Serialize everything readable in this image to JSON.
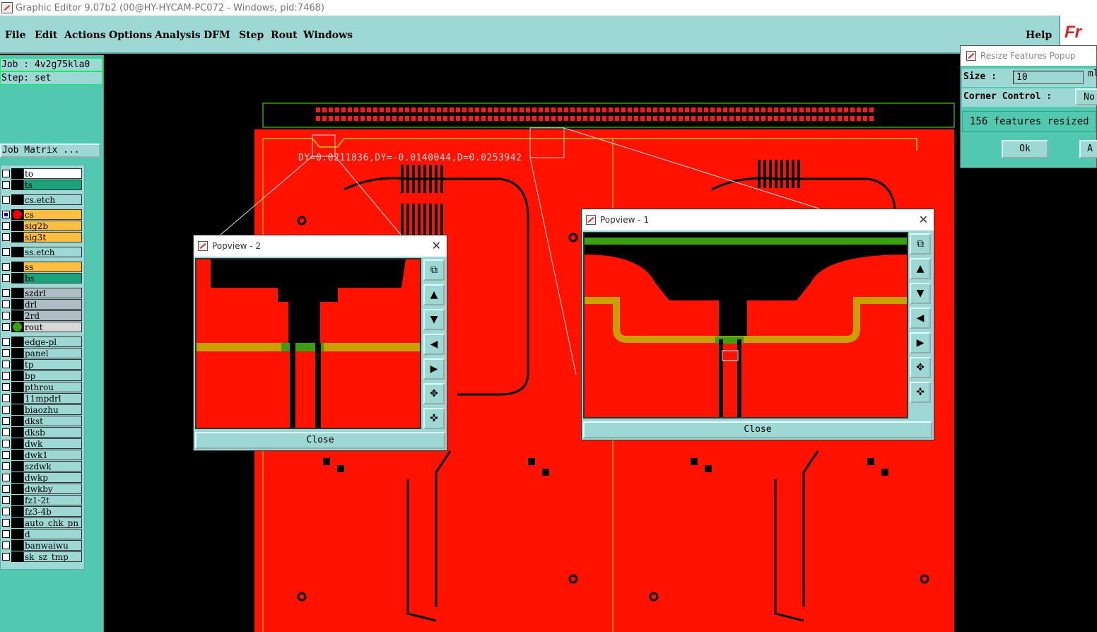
{
  "window": {
    "title": "Graphic Editor 9.07b2 (00@HY-HYCAM-PC072 - Windows, pid:7468)"
  },
  "menu": {
    "items": [
      "File",
      "Edit",
      "Actions",
      "Options",
      "Analysis",
      "DFM",
      "Step",
      "Rout",
      "Windows"
    ],
    "help": "Help",
    "logo_text": "Fr"
  },
  "job": {
    "job_label": "Job : 4v2g75kla0",
    "step_label": "Step: set",
    "matrix_button": "Job Matrix ..."
  },
  "layers": [
    {
      "name": "to",
      "color": "#ffffff",
      "mark": ""
    },
    {
      "name": "ts",
      "color": "#1aa37a",
      "mark": ""
    },
    {
      "name": "cs.etch",
      "color": "#9ed8d4",
      "mark": ""
    },
    {
      "name": "cs",
      "color": "#ffbe40",
      "mark": "red",
      "checked": true
    },
    {
      "name": "sig2b",
      "color": "#ffbe40",
      "mark": ""
    },
    {
      "name": "sig3t",
      "color": "#ffbe40",
      "mark": ""
    },
    {
      "name": "ss.etch",
      "color": "#9ed8d4",
      "mark": ""
    },
    {
      "name": "ss",
      "color": "#ffbe40",
      "mark": ""
    },
    {
      "name": "bs",
      "color": "#1aa37a",
      "mark": ""
    },
    {
      "name": "szdrl",
      "color": "#b0bcc6",
      "mark": ""
    },
    {
      "name": "drl",
      "color": "#b0bcc6",
      "mark": ""
    },
    {
      "name": "2rd",
      "color": "#b0bcc6",
      "mark": ""
    },
    {
      "name": "rout",
      "color": "#d8d8d8",
      "mark": "green"
    },
    {
      "name": "edge-pl",
      "color": "#9ed8d4",
      "mark": ""
    },
    {
      "name": "panel",
      "color": "#9ed8d4",
      "mark": ""
    },
    {
      "name": "tp",
      "color": "#9ed8d4",
      "mark": ""
    },
    {
      "name": "bp",
      "color": "#9ed8d4",
      "mark": ""
    },
    {
      "name": "pthrou",
      "color": "#9ed8d4",
      "mark": ""
    },
    {
      "name": "11mpdrl",
      "color": "#9ed8d4",
      "mark": ""
    },
    {
      "name": "biaozhu",
      "color": "#9ed8d4",
      "mark": ""
    },
    {
      "name": "dkst",
      "color": "#9ed8d4",
      "mark": ""
    },
    {
      "name": "dksb",
      "color": "#9ed8d4",
      "mark": ""
    },
    {
      "name": "dwk",
      "color": "#9ed8d4",
      "mark": ""
    },
    {
      "name": "dwk1",
      "color": "#9ed8d4",
      "mark": ""
    },
    {
      "name": "szdwk",
      "color": "#9ed8d4",
      "mark": ""
    },
    {
      "name": "dwkp",
      "color": "#9ed8d4",
      "mark": ""
    },
    {
      "name": "dwkby",
      "color": "#9ed8d4",
      "mark": ""
    },
    {
      "name": "fz1-2t",
      "color": "#9ed8d4",
      "mark": ""
    },
    {
      "name": "fz3-4b",
      "color": "#9ed8d4",
      "mark": ""
    },
    {
      "name": "auto_chk_pn",
      "color": "#9ed8d4",
      "mark": ""
    },
    {
      "name": "d",
      "color": "#9ed8d4",
      "mark": ""
    },
    {
      "name": "banwaiwu",
      "color": "#9ed8d4",
      "mark": ""
    },
    {
      "name": "sk_sz_tmp",
      "color": "#9ed8d4",
      "mark": ""
    }
  ],
  "canvas": {
    "measure_readout": "DY=0.0211836,DY=-0.0140044,D=0.0253942"
  },
  "popview2": {
    "title": "Popview - 2",
    "close_label": "Close"
  },
  "popview1": {
    "title": "Popview - 1",
    "close_label": "Close"
  },
  "resize_popup": {
    "title": "Resize Features Popup",
    "size_label": "Size :",
    "size_value": "10",
    "size_unit": "ml",
    "corner_label": "Corner Control :",
    "corner_value": "No",
    "message": "156 features resized",
    "ok_label": "Ok",
    "apply_label": "A"
  },
  "colors": {
    "copper": "#ff1200",
    "ui_teal": "#9ed8d4",
    "panel_green": "#52c8b0",
    "trace_yellow": "#c8a000",
    "trace_green": "#3aa010"
  }
}
